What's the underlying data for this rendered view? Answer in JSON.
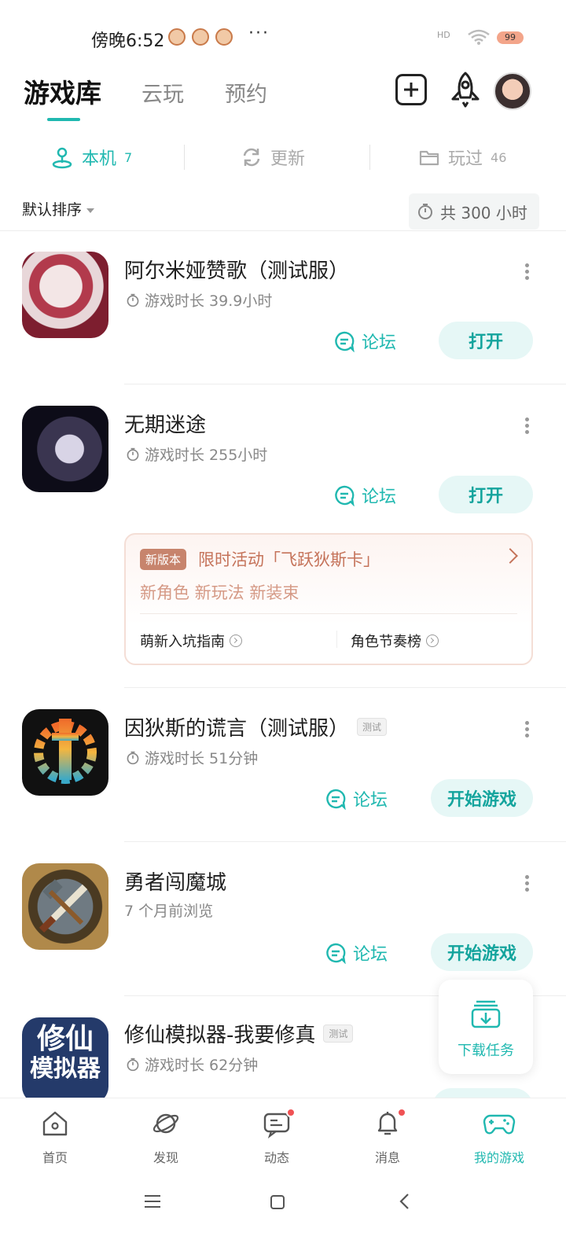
{
  "status_bar": {
    "time": "傍晚6:52",
    "more": "···",
    "signal": "HD",
    "battery": "99"
  },
  "header": {
    "tabs": [
      {
        "label": "游戏库",
        "active": true
      },
      {
        "label": "云玩",
        "active": false
      },
      {
        "label": "预约",
        "active": false
      }
    ]
  },
  "subtabs": [
    {
      "label": "本机",
      "count": "7",
      "active": true
    },
    {
      "label": "更新",
      "count": "",
      "active": false
    },
    {
      "label": "玩过",
      "count": "46",
      "active": false
    }
  ],
  "sort": {
    "label": "默认排序",
    "total": "共 300 小时"
  },
  "games": [
    {
      "title": "阿尔米娅赞歌（测试服）",
      "tag": "",
      "meta": "游戏时长 39.9小时",
      "forum": "论坛",
      "action": "打开"
    },
    {
      "title": "无期迷途",
      "tag": "",
      "meta": "游戏时长 255小时",
      "forum": "论坛",
      "action": "打开"
    },
    {
      "title": "因狄斯的谎言（测试服）",
      "tag": "测试",
      "meta": "游戏时长 51分钟",
      "forum": "论坛",
      "action": "开始游戏"
    },
    {
      "title": "勇者闯魔城",
      "tag": "",
      "meta": "7 个月前浏览",
      "forum": "论坛",
      "action": "开始游戏"
    },
    {
      "title": "修仙模拟器-我要修真",
      "tag": "测试",
      "meta": "游戏时长 62分钟",
      "icon_text_1": "修仙",
      "icon_text_2": "模拟器"
    }
  ],
  "event": {
    "badge": "新版本",
    "title": "限时活动「飞跃狄斯卡」",
    "subtitle": "新角色 新玩法 新装束",
    "links": [
      "萌新入坑指南",
      "角色节奏榜"
    ]
  },
  "download": {
    "label": "下载任务"
  },
  "bottom_nav": [
    {
      "label": "首页",
      "active": false
    },
    {
      "label": "发现",
      "active": false
    },
    {
      "label": "动态",
      "active": false,
      "dot": true
    },
    {
      "label": "消息",
      "active": false,
      "dot": true
    },
    {
      "label": "我的游戏",
      "active": true
    }
  ],
  "colors": {
    "accent": "#20b8b0",
    "accent_bg": "#e6f7f6",
    "event_accent": "#c5735a",
    "badge_red": "#f05254"
  }
}
